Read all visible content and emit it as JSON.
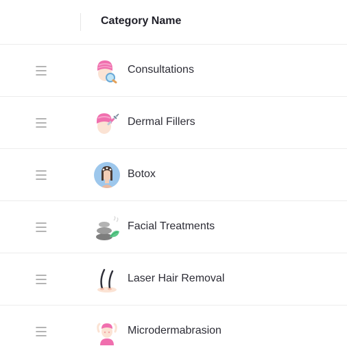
{
  "table": {
    "column_header": "Category Name",
    "rows": [
      {
        "label": "Consultations",
        "icon": "consultation-icon"
      },
      {
        "label": "Dermal Fillers",
        "icon": "dermal-fillers-icon"
      },
      {
        "label": "Botox",
        "icon": "botox-icon"
      },
      {
        "label": "Facial Treatments",
        "icon": "facial-treatments-icon"
      },
      {
        "label": "Laser Hair Removal",
        "icon": "laser-hair-removal-icon"
      },
      {
        "label": "Microdermabrasion",
        "icon": "microdermabrasion-icon"
      }
    ]
  },
  "colors": {
    "accent_pink": "#f06fae",
    "skin": "#fbe3d4",
    "drag_handle": "#9a9a9a",
    "divider": "#ececec"
  }
}
